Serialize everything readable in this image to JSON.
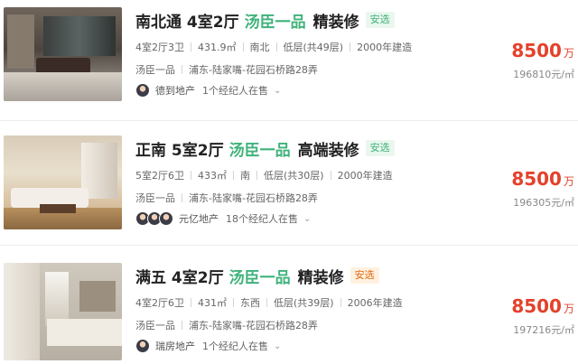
{
  "listings": [
    {
      "title": {
        "main": "南北通 4室2厅",
        "estate": "汤臣一品",
        "decoration": "精装修",
        "badge": "安选"
      },
      "attrs": [
        "4室2厅3卫",
        "431.9㎡",
        "南北",
        "低层(共49层)",
        "2000年建造"
      ],
      "location": [
        "汤臣一品",
        "浦东-陆家嘴-花园石桥路28弄"
      ],
      "agent": {
        "company": "德到地产",
        "count": "1个经纪人在售"
      },
      "price": {
        "total": "8500",
        "unit": "万",
        "per": "196810元/㎡"
      },
      "badge_style": "green"
    },
    {
      "title": {
        "main": "正南 5室2厅",
        "estate": "汤臣一品",
        "decoration": "高端装修",
        "badge": "安选"
      },
      "attrs": [
        "5室2厅6卫",
        "433㎡",
        "南",
        "低层(共30层)",
        "2000年建造"
      ],
      "location": [
        "汤臣一品",
        "浦东-陆家嘴-花园石桥路28弄"
      ],
      "agent": {
        "company": "元亿地产",
        "count": "18个经纪人在售"
      },
      "price": {
        "total": "8500",
        "unit": "万",
        "per": "196305元/㎡"
      },
      "badge_style": "green"
    },
    {
      "title": {
        "main": "满五 4室2厅",
        "estate": "汤臣一品",
        "decoration": "精装修",
        "badge": "安选"
      },
      "attrs": [
        "4室2厅6卫",
        "431㎡",
        "东西",
        "低层(共39层)",
        "2006年建造"
      ],
      "location": [
        "汤臣一品",
        "浦东-陆家嘴-花园石桥路28弄"
      ],
      "agent": {
        "company": "瑞房地产",
        "count": "1个经纪人在售"
      },
      "price": {
        "total": "8500",
        "unit": "万",
        "per": "197216元/㎡"
      },
      "badge_style": "orange"
    }
  ],
  "icons": {
    "expand": "chevron-down-icon"
  },
  "colors": {
    "estate": "#3fb27a",
    "price": "#e4412b",
    "badge_orange": "#e06a13"
  }
}
